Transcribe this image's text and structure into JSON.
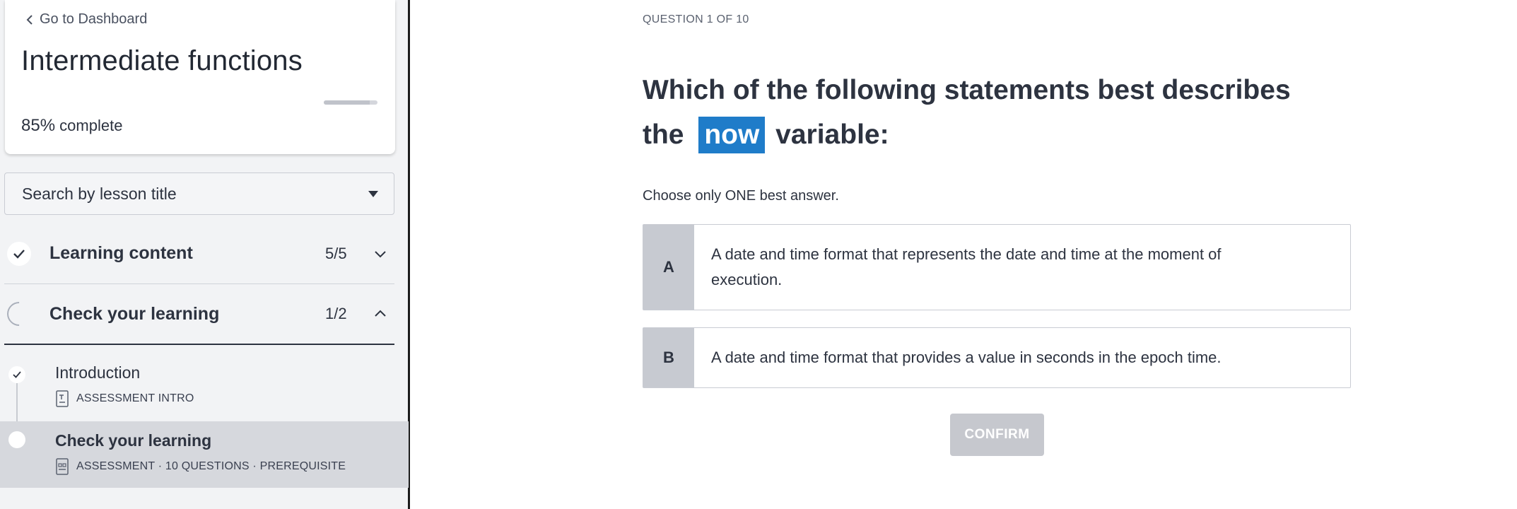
{
  "sidebar": {
    "back_link": "Go to Dashboard",
    "course_title": "Intermediate functions",
    "progress": {
      "percent_label": "85%",
      "suffix": "complete",
      "value": 0.85
    },
    "search": {
      "placeholder": "Search by lesson title"
    },
    "sections": [
      {
        "title": "Learning content",
        "count": "5/5",
        "status": "complete",
        "expanded": false
      },
      {
        "title": "Check your learning",
        "count": "1/2",
        "status": "in-progress",
        "expanded": true
      }
    ],
    "lessons": [
      {
        "title": "Introduction",
        "meta": "ASSESSMENT INTRO",
        "status": "complete"
      },
      {
        "title": "Check your learning",
        "meta": "ASSESSMENT · 10 QUESTIONS · PREREQUISITE",
        "status": "current"
      }
    ]
  },
  "quiz": {
    "counter": "QUESTION 1 OF 10",
    "question_before": "Which of the following statements best describes the",
    "question_code": "now",
    "question_after": "variable:",
    "instruction": "Choose only ONE best answer.",
    "options": [
      {
        "letter": "A",
        "text": "A date and time format that represents the date and time at the moment of execution."
      },
      {
        "letter": "B",
        "text": "A date and time format that provides a value in seconds in the epoch time."
      }
    ],
    "confirm_label": "CONFIRM"
  },
  "colors": {
    "accent_code_bg": "#1f7cc9",
    "sidebar_bg": "#f2f3f5",
    "option_letter_bg": "#c7cad1",
    "confirm_disabled_bg": "#c6c8ce"
  }
}
